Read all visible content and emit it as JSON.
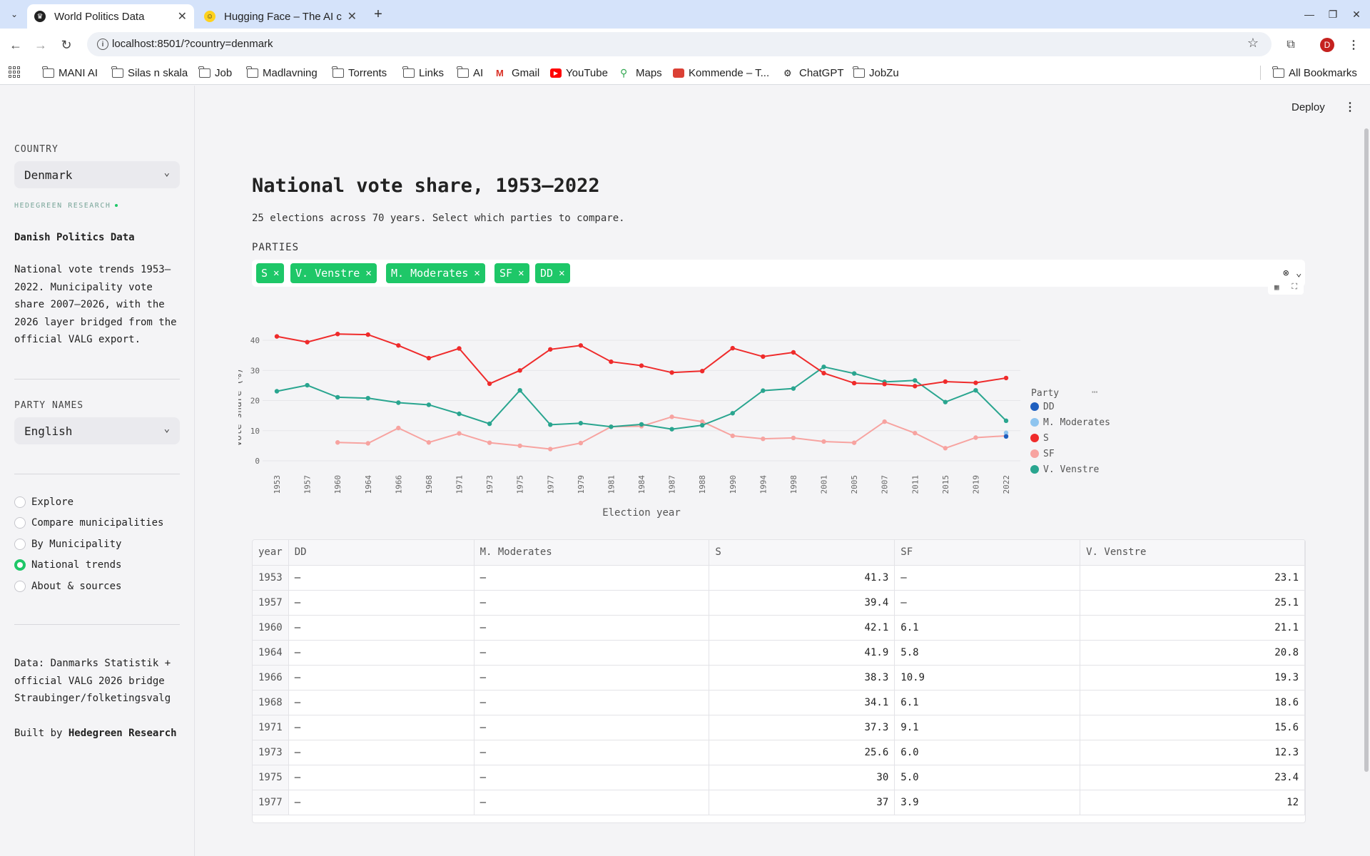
{
  "browser": {
    "tabs": [
      {
        "title": "World Politics Data",
        "active": true
      },
      {
        "title": "Hugging Face – The AI co",
        "active": false
      }
    ],
    "url": "localhost:8501/?country=denmark",
    "profile_initial": "D",
    "bookmarks": [
      "MANI AI",
      "Silas n skala",
      "Job",
      "Madlavning",
      "Torrents",
      "Links",
      "AI",
      "Gmail",
      "YouTube",
      "Maps",
      "Kommende – T...",
      "ChatGPT",
      "JobZu"
    ],
    "all_bookmarks_label": "All Bookmarks"
  },
  "sidebar": {
    "country_label": "COUNTRY",
    "country_value": "Denmark",
    "brand_tag": "HEDEGREEN RESEARCH",
    "title": "Danish Politics Data",
    "description": "National vote trends 1953–2022. Municipality vote share 2007–2026, with the 2026 layer bridged from the official VALG export.",
    "party_names_label": "PARTY NAMES",
    "party_names_value": "English",
    "nav": [
      "Explore",
      "Compare municipalities",
      "By Municipality",
      "National trends",
      "About & sources"
    ],
    "nav_selected": "National trends",
    "data_note_line1": "Data: Danmarks Statistik +",
    "data_note_line2": "official VALG 2026 bridge",
    "data_note_line3": "Straubinger/folketingsvalg",
    "built_by_prefix": "Built by",
    "built_by_name": "Hedegreen Research"
  },
  "main": {
    "deploy_label": "Deploy",
    "title": "National vote share, 1953–2022",
    "caption": "25 elections across 70 years. Select which parties to compare.",
    "parties_label": "PARTIES",
    "chips": [
      "S",
      "V. Venstre",
      "M. Moderates",
      "SF",
      "DD"
    ]
  },
  "chart_data": {
    "type": "line",
    "x": [
      1953,
      1957,
      1960,
      1964,
      1966,
      1968,
      1971,
      1973,
      1975,
      1977,
      1979,
      1981,
      1984,
      1987,
      1988,
      1990,
      1994,
      1998,
      2001,
      2005,
      2007,
      2011,
      2015,
      2019,
      2022
    ],
    "xlabel": "Election year",
    "ylabel": "Vote share (%)",
    "ylim": [
      0,
      45
    ],
    "yticks": [
      0,
      10,
      20,
      30,
      40
    ],
    "legend_title": "Party",
    "legend_position": "right",
    "grid": true,
    "series": [
      {
        "name": "DD",
        "color": "#1f5fbf",
        "values": [
          null,
          null,
          null,
          null,
          null,
          null,
          null,
          null,
          null,
          null,
          null,
          null,
          null,
          null,
          null,
          null,
          null,
          null,
          null,
          null,
          null,
          null,
          null,
          null,
          8.1
        ]
      },
      {
        "name": "M. Moderates",
        "color": "#8ec4ef",
        "values": [
          null,
          null,
          null,
          null,
          null,
          null,
          null,
          null,
          null,
          null,
          null,
          null,
          null,
          null,
          null,
          null,
          null,
          null,
          null,
          null,
          null,
          null,
          null,
          null,
          9.3
        ]
      },
      {
        "name": "S",
        "color": "#ef2b2b",
        "values": [
          41.3,
          39.4,
          42.1,
          41.9,
          38.3,
          34.1,
          37.3,
          25.6,
          30,
          37,
          38.3,
          32.9,
          31.6,
          29.3,
          29.8,
          37.4,
          34.6,
          36,
          29.1,
          25.8,
          25.5,
          24.8,
          26.3,
          25.9,
          27.5
        ]
      },
      {
        "name": "SF",
        "color": "#f7a3a0",
        "values": [
          null,
          null,
          6.1,
          5.8,
          10.9,
          6.1,
          9.1,
          6.0,
          5.0,
          3.9,
          5.9,
          11.3,
          11.5,
          14.6,
          13.0,
          8.3,
          7.3,
          7.6,
          6.4,
          6.0,
          13.0,
          9.2,
          4.2,
          7.7,
          8.3
        ]
      },
      {
        "name": "V. Venstre",
        "color": "#29a58f",
        "values": [
          23.1,
          25.1,
          21.1,
          20.8,
          19.3,
          18.6,
          15.6,
          12.3,
          23.4,
          12,
          12.5,
          11.3,
          12.1,
          10.5,
          11.8,
          15.8,
          23.3,
          24,
          31.2,
          29,
          26.2,
          26.7,
          19.5,
          23.4,
          13.3
        ]
      }
    ]
  },
  "table": {
    "columns": [
      "year",
      "DD",
      "M. Moderates",
      "S",
      "SF",
      "V. Venstre"
    ],
    "rows": [
      [
        "1953",
        "–",
        "–",
        "41.3",
        "–",
        "23.1"
      ],
      [
        "1957",
        "–",
        "–",
        "39.4",
        "–",
        "25.1"
      ],
      [
        "1960",
        "–",
        "–",
        "42.1",
        "6.1",
        "21.1"
      ],
      [
        "1964",
        "–",
        "–",
        "41.9",
        "5.8",
        "20.8"
      ],
      [
        "1966",
        "–",
        "–",
        "38.3",
        "10.9",
        "19.3"
      ],
      [
        "1968",
        "–",
        "–",
        "34.1",
        "6.1",
        "18.6"
      ],
      [
        "1971",
        "–",
        "–",
        "37.3",
        "9.1",
        "15.6"
      ],
      [
        "1973",
        "–",
        "–",
        "25.6",
        "6.0",
        "12.3"
      ],
      [
        "1975",
        "–",
        "–",
        "30",
        "5.0",
        "23.4"
      ],
      [
        "1977",
        "–",
        "–",
        "37",
        "3.9",
        "12"
      ]
    ]
  },
  "colors": {
    "accent": "#1ec768",
    "tabstrip": "#d5e3fa"
  },
  "icons": [
    "tab-list-icon",
    "streamlit-favicon",
    "huggingface-favicon",
    "new-tab-icon",
    "minimize-icon",
    "restore-icon",
    "close-icon",
    "back-icon",
    "forward-icon",
    "reload-icon",
    "site-info-icon",
    "bookmark-star-icon",
    "extensions-icon",
    "kebab-menu-icon",
    "apps-icon",
    "folder-icon",
    "chevron-down-icon",
    "table-icon",
    "fullscreen-icon"
  ]
}
